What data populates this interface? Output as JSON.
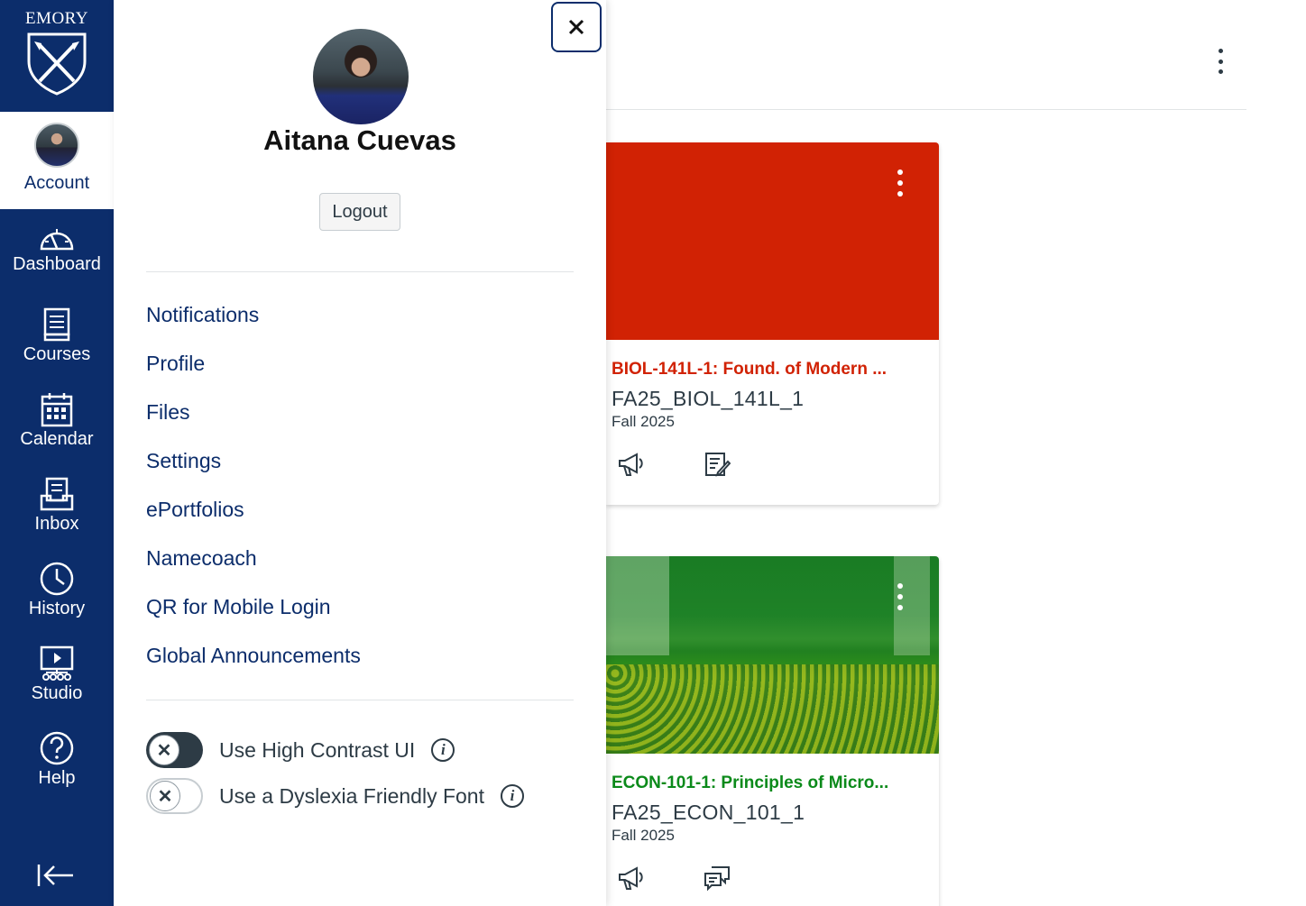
{
  "nav": {
    "logo_text": "EMORY",
    "account_label": "Account",
    "items": [
      {
        "label": "Dashboard",
        "icon": "dashboard-icon"
      },
      {
        "label": "Courses",
        "icon": "courses-icon"
      },
      {
        "label": "Calendar",
        "icon": "calendar-icon"
      },
      {
        "label": "Inbox",
        "icon": "inbox-icon"
      },
      {
        "label": "History",
        "icon": "history-icon"
      },
      {
        "label": "Studio",
        "icon": "studio-icon"
      },
      {
        "label": "Help",
        "icon": "help-icon"
      }
    ],
    "brand_color": "#0c2d6b"
  },
  "tray": {
    "user_name": "Aitana Cuevas",
    "logout_label": "Logout",
    "links": [
      "Notifications",
      "Profile",
      "Files",
      "Settings",
      "ePortfolios",
      "Namecoach",
      "QR for Mobile Login",
      "Global Announcements"
    ],
    "toggles": [
      {
        "label": "Use High Contrast UI",
        "on": false
      },
      {
        "label": "Use a Dyslexia Friendly Font",
        "on": false
      }
    ]
  },
  "cards": [
    {
      "title": "BIOL-141L-1: Found. of Modern ...",
      "code": "FA25_BIOL_141L_1",
      "term": "Fall 2025",
      "color": "#d12204",
      "icons": [
        "announcements-icon",
        "assignments-icon"
      ]
    },
    {
      "title": "ECON-101-1: Principles of Micro...",
      "code": "FA25_ECON_101_1",
      "term": "Fall 2025",
      "color": "#0b8a1a",
      "icons": [
        "announcements-icon",
        "discussions-icon"
      ]
    }
  ]
}
